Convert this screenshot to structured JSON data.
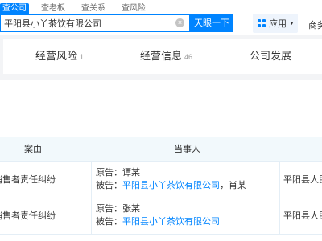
{
  "search": {
    "tabs": [
      "查公司",
      "查老板",
      "查关系",
      "查风险"
    ],
    "query": "平阳县小丫茶饮有限公司",
    "clear_glyph": "×",
    "button_label": "天眼一下"
  },
  "header": {
    "app_label": "应用",
    "app_caret": "▼",
    "biz_label": "商务"
  },
  "nav": {
    "tabs": [
      {
        "label": "经营风险",
        "count": "1"
      },
      {
        "label": "经营信息",
        "count": "46"
      },
      {
        "label": "公司发展",
        "count": ""
      }
    ]
  },
  "table": {
    "headers": [
      "案由",
      "当事人"
    ],
    "rows": [
      {
        "case": "销售者责任纠纷",
        "plaintiff_label": "原告：",
        "plaintiff": "谭某",
        "defendant_label": "被告：",
        "defendant_company": "平阳县小丫茶饮有限公司",
        "defendant_extra": "，肖某",
        "court": "平阳县人民"
      },
      {
        "case": "销售者责任纠纷",
        "plaintiff_label": "原告：",
        "plaintiff": "张某",
        "defendant_label": "被告：",
        "defendant_company": "平阳县小丫茶饮有限公司",
        "defendant_extra": "",
        "court": "平阳县人民"
      }
    ]
  },
  "colors": {
    "accent": "#0084ff",
    "page_bg": "#f3f4f6",
    "table_header_bg": "#f2f9fc"
  }
}
